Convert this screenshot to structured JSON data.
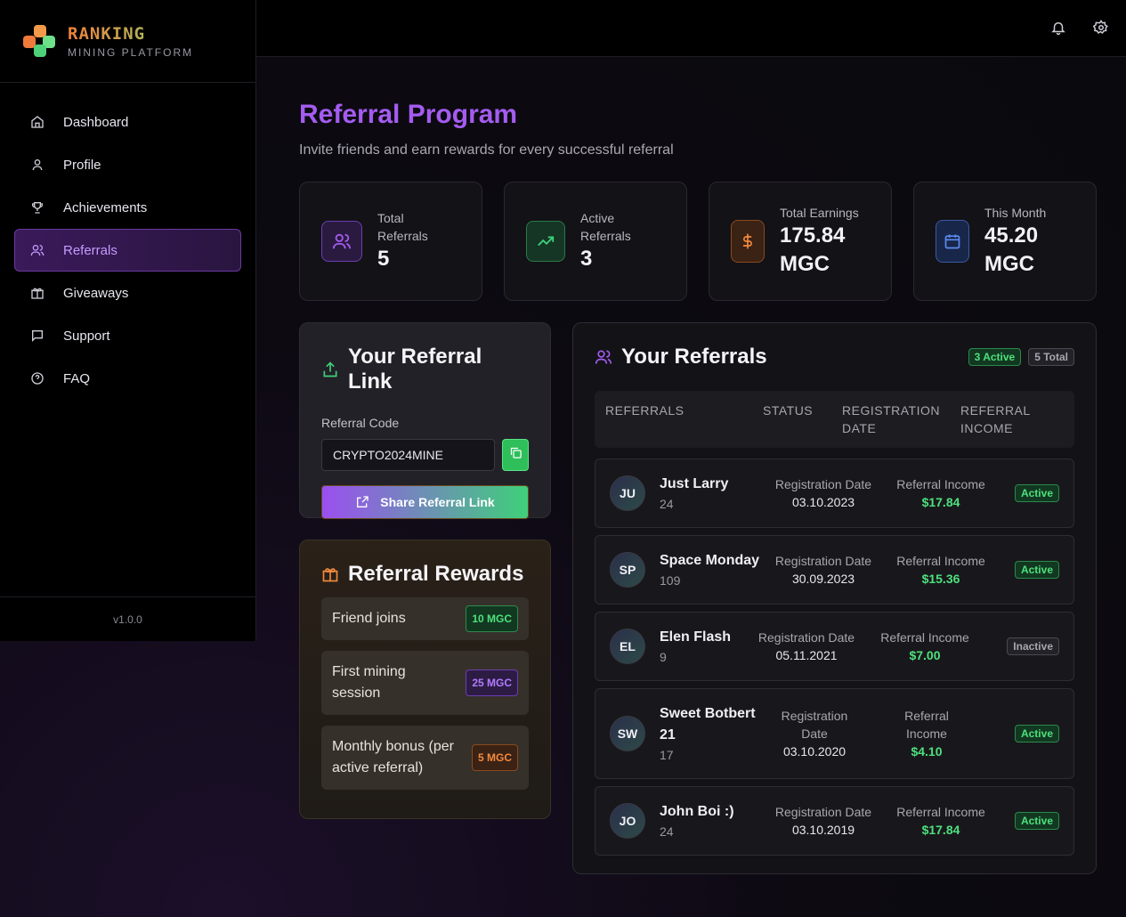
{
  "brand": {
    "title": "RANKING",
    "subtitle": "MINING PLATFORM"
  },
  "sidebar": {
    "items": [
      {
        "label": "Dashboard",
        "icon": "home-icon"
      },
      {
        "label": "Profile",
        "icon": "user-icon"
      },
      {
        "label": "Achievements",
        "icon": "trophy-icon"
      },
      {
        "label": "Referrals",
        "icon": "users-icon",
        "active": true
      },
      {
        "label": "Giveaways",
        "icon": "gift-icon"
      },
      {
        "label": "Support",
        "icon": "message-icon"
      },
      {
        "label": "FAQ",
        "icon": "help-circle-icon"
      }
    ],
    "version": "v1.0.0"
  },
  "topbar": {
    "icons": [
      "bell-icon",
      "gear-icon"
    ]
  },
  "page": {
    "title": "Referral Program",
    "subtitle": "Invite friends and earn rewards for every successful referral"
  },
  "stats": [
    {
      "label": "Total Referrals",
      "value": "5",
      "icon": "users-icon",
      "color": "#a45cf0"
    },
    {
      "label": "Active Referrals",
      "value": "3",
      "icon": "trending-up-icon",
      "color": "#3fd07a"
    },
    {
      "label": "Total Earnings",
      "value": "175.84 MGC",
      "icon": "dollar-icon",
      "color": "#f28a3e"
    },
    {
      "label": "This Month",
      "value": "45.20 MGC",
      "icon": "calendar-icon",
      "color": "#5b8cf0"
    }
  ],
  "link_card": {
    "title": "Your Referral Link",
    "code_label": "Referral Code",
    "code_value": "CRYPTO2024MINE",
    "share_label": "Share Referral Link"
  },
  "rewards": {
    "title": "Referral Rewards",
    "items": [
      {
        "label": "Friend joins",
        "badge": "10 MGC",
        "tone": "green"
      },
      {
        "label": "First mining session",
        "badge": "25 MGC",
        "tone": "purple"
      },
      {
        "label": "Monthly bonus (per active referral)",
        "badge": "5 MGC",
        "tone": "orange"
      }
    ]
  },
  "referrals": {
    "title": "Your Referrals",
    "active_badge": "3 Active",
    "total_badge": "5 Total",
    "columns": [
      "REFERRALS",
      "STATUS",
      "REGISTRATION DATE",
      "REFERRAL INCOME"
    ],
    "date_label": "Registration Date",
    "income_label": "Referral Income",
    "rows": [
      {
        "initials": "JU",
        "name": "Just Larry",
        "sub": "24",
        "date": "03.10.2023",
        "income": "$17.84",
        "status": "Active"
      },
      {
        "initials": "SP",
        "name": "Space Monday",
        "sub": "109",
        "date": "30.09.2023",
        "income": "$15.36",
        "status": "Active"
      },
      {
        "initials": "EL",
        "name": "Elen Flash",
        "sub": "9",
        "date": "05.11.2021",
        "income": "$7.00",
        "status": "Inactive"
      },
      {
        "initials": "SW",
        "name": "Sweet Botbert 21",
        "sub": "17",
        "date": "03.10.2020",
        "income": "$4.10",
        "status": "Active"
      },
      {
        "initials": "JO",
        "name": "John Boi :)",
        "sub": "24",
        "date": "03.10.2019",
        "income": "$17.84",
        "status": "Active"
      }
    ]
  }
}
